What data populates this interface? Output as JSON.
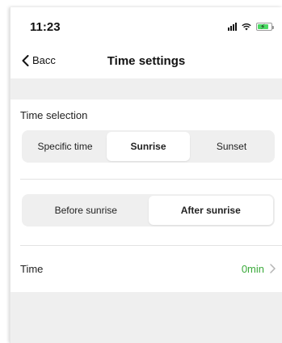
{
  "status": {
    "time": "11:23"
  },
  "nav": {
    "back_label": "Bacc",
    "title": "Time settings"
  },
  "time_selection": {
    "label": "Time selection",
    "options": [
      "Specific time",
      "Sunrise",
      "Sunset"
    ],
    "selected": "Sunrise"
  },
  "offset_direction": {
    "options": [
      "Before sunrise",
      "After sunrise"
    ],
    "selected": "After sunrise"
  },
  "time_row": {
    "label": "Time",
    "value": "0min"
  },
  "colors": {
    "accent_green": "#3aaa3a",
    "battery_green": "#4cd964",
    "background": "#efefef"
  },
  "icons": {
    "back": "chevron-left-icon",
    "row": "chevron-right-icon",
    "signal": "signal-icon",
    "wifi": "wifi-icon",
    "battery": "battery-charging-icon"
  }
}
